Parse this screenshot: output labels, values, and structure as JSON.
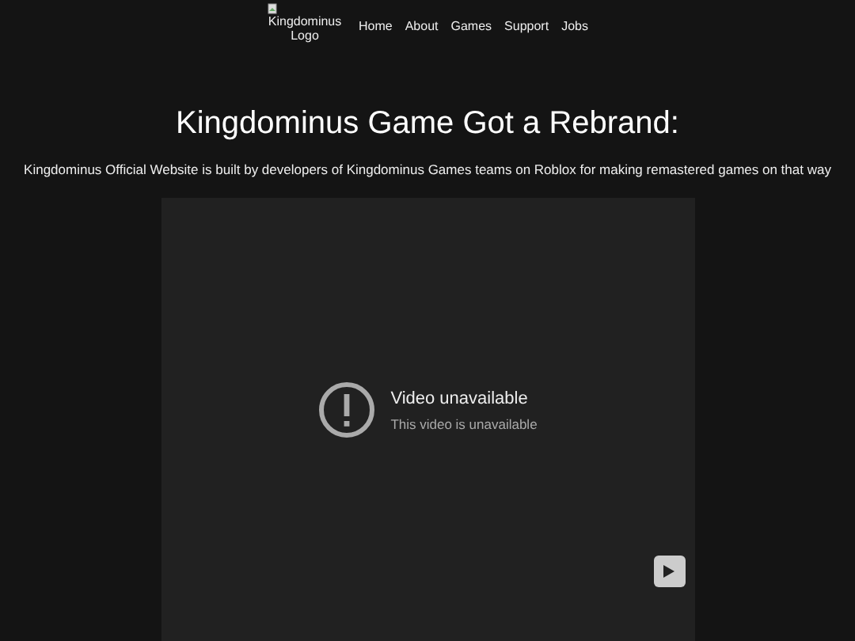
{
  "nav": {
    "logo_alt": "Kingdominus Logo",
    "links": [
      "Home",
      "About",
      "Games",
      "Support",
      "Jobs"
    ]
  },
  "heading": "Kingdominus Game Got a Rebrand:",
  "description": "Kingdominus Official Website is built by developers of Kingdominus Games teams on Roblox for making remastered games on that way",
  "video": {
    "title": "Video unavailable",
    "message": "This video is unavailable"
  }
}
